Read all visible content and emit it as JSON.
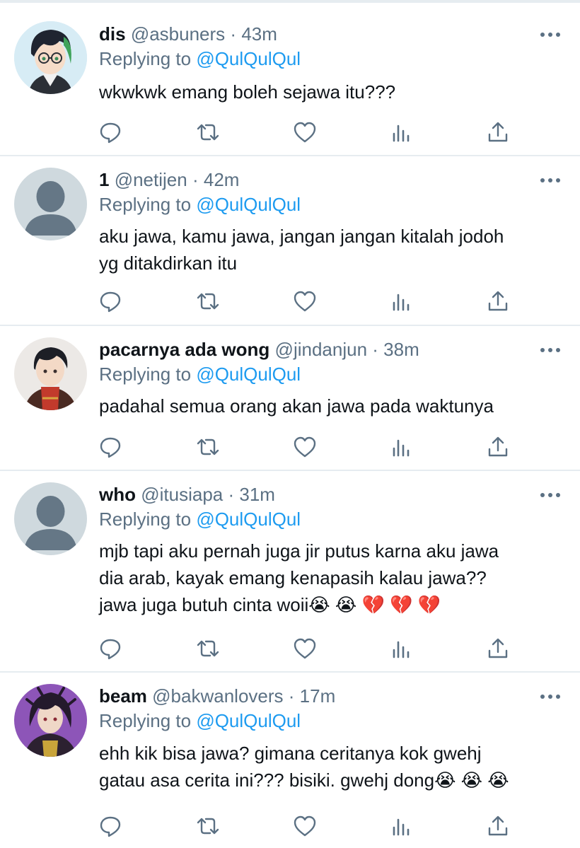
{
  "tweets": [
    {
      "name": "dis",
      "handle": "@asbuners",
      "sep": "·",
      "time": "43m",
      "replying_prefix": "Replying to",
      "replying_to": "@QulQulQul",
      "text": "wkwkwk emang boleh sejawa itu???",
      "avatar_icon": "anime-boy-green-hair-glasses"
    },
    {
      "name": "1",
      "handle": "@netijen",
      "sep": "·",
      "time": "42m",
      "replying_prefix": "Replying to",
      "replying_to": "@QulQulQul",
      "text": "aku jawa, kamu jawa, jangan jangan kitalah jodoh\nyg ditakdirkan itu",
      "avatar_icon": "default-profile-silhouette"
    },
    {
      "name": "pacarnya ada wong",
      "handle": "@jindanjun",
      "sep": "·",
      "time": "38m",
      "replying_prefix": "Replying to",
      "replying_to": "@QulQulQul",
      "text": "padahal semua orang akan jawa pada waktunya",
      "avatar_icon": "anime-boy-black-hair-red-shirt"
    },
    {
      "name": "who",
      "handle": "@itusiapa",
      "sep": "·",
      "time": "31m",
      "replying_prefix": "Replying to",
      "replying_to": "@QulQulQul",
      "text": "mjb tapi aku pernah juga jir putus karna aku jawa\ndia arab, kayak emang kenapasih kalau jawa??\njawa juga butuh cinta woii😭 😭 💔 💔 💔",
      "avatar_icon": "default-profile-silhouette"
    },
    {
      "name": "beam",
      "handle": "@bakwanlovers",
      "sep": "·",
      "time": "17m",
      "replying_prefix": "Replying to",
      "replying_to": "@QulQulQul",
      "text": "ehh kik bisa jawa? gimana ceritanya kok gwehj\ngatau asa cerita ini??? bisiki. gwehj dong😭 😭 😭",
      "avatar_icon": "anime-boy-purple-hair"
    }
  ],
  "colors": {
    "text": "#0f1419",
    "secondary": "#5b7083",
    "link": "#1d9bf0",
    "divider": "#e6ecf0"
  },
  "action_icons": [
    "reply-icon",
    "retweet-icon",
    "like-icon",
    "analytics-icon",
    "share-icon"
  ]
}
